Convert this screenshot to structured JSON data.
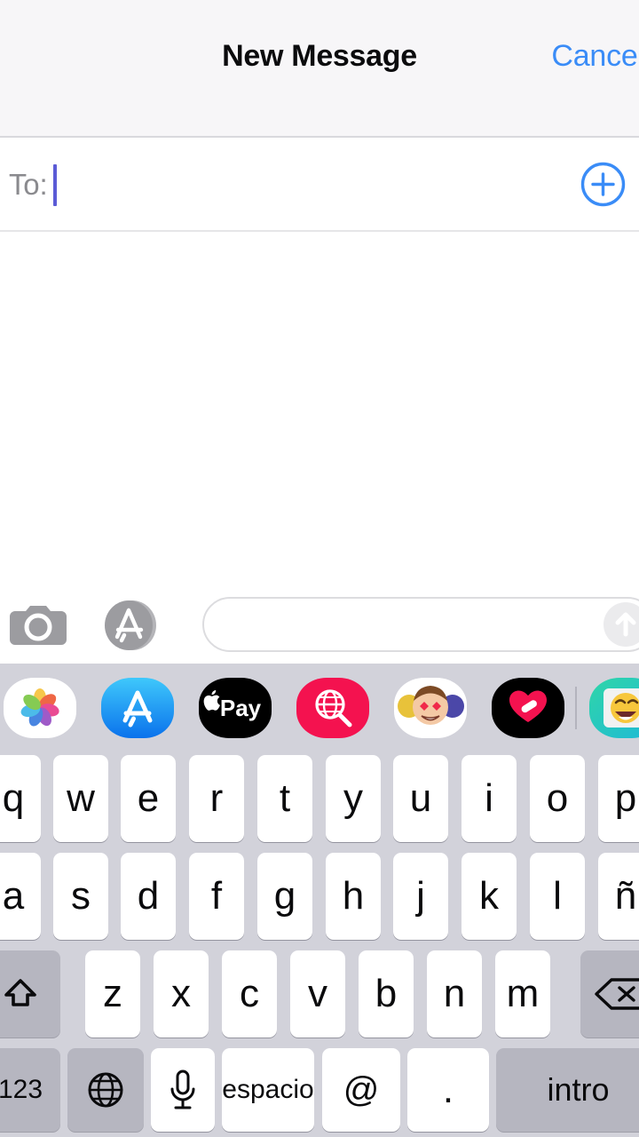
{
  "app": {
    "name": "Messages",
    "platform": "iOS",
    "language": "es"
  },
  "navbar": {
    "title": "New Message",
    "cancel_label": "Cancel",
    "cancel_color": "#3a8cf7",
    "background": "#f7f6f8"
  },
  "recipient_field": {
    "label": "To:",
    "value": "",
    "placeholder": "",
    "caret_visible": true,
    "caret_color": "#5b5bd6",
    "add_contact_icon": "plus-circle-icon",
    "add_contact_color": "#3a8cf7"
  },
  "conversation": {
    "messages": [],
    "empty": true,
    "background": "#ffffff"
  },
  "input_bar": {
    "camera_icon": "camera-icon",
    "appstore_icon": "app-store-icon",
    "message_value": "",
    "message_placeholder": "",
    "send_icon": "arrow-up-icon",
    "send_enabled": false,
    "icon_color": "#a0a0a4"
  },
  "app_drawer": {
    "background": "#d2d2da",
    "apps": [
      {
        "name": "photos",
        "label": "Photos",
        "icon": "photos-pinwheel-icon",
        "bg": "#ffffff"
      },
      {
        "name": "app-store",
        "label": "App Store",
        "icon": "app-store-icon",
        "bg": "#1e9cf5"
      },
      {
        "name": "apple-pay",
        "label": "Apple Pay",
        "icon": "apple-pay-icon",
        "bg": "#000000"
      },
      {
        "name": "images-search",
        "label": "#images",
        "icon": "magnifier-globe-icon",
        "bg": "#f4124f"
      },
      {
        "name": "memoji",
        "label": "Memoji",
        "icon": "memoji-stickers-icon",
        "bg": "#ffffff"
      },
      {
        "name": "digital-touch",
        "label": "Digital Touch",
        "icon": "heart-icon",
        "bg": "#000000"
      },
      {
        "name": "emoji-app",
        "label": "Emoji",
        "icon": "laughing-emoji-icon",
        "bg": "#27c8b7"
      }
    ]
  },
  "keyboard": {
    "layout": "qwerty-spanish",
    "background": "#d2d2da",
    "key_color": "#ffffff",
    "special_key_color": "#b6b6c0",
    "rows": [
      {
        "id": "row1",
        "keys": [
          {
            "label": "q",
            "name": "key-q"
          },
          {
            "label": "w",
            "name": "key-w"
          },
          {
            "label": "e",
            "name": "key-e"
          },
          {
            "label": "r",
            "name": "key-r"
          },
          {
            "label": "t",
            "name": "key-t"
          },
          {
            "label": "y",
            "name": "key-y"
          },
          {
            "label": "u",
            "name": "key-u"
          },
          {
            "label": "i",
            "name": "key-i"
          },
          {
            "label": "o",
            "name": "key-o"
          },
          {
            "label": "p",
            "name": "key-p"
          }
        ]
      },
      {
        "id": "row2",
        "keys": [
          {
            "label": "a",
            "name": "key-a"
          },
          {
            "label": "s",
            "name": "key-s"
          },
          {
            "label": "d",
            "name": "key-d"
          },
          {
            "label": "f",
            "name": "key-f"
          },
          {
            "label": "g",
            "name": "key-g"
          },
          {
            "label": "h",
            "name": "key-h"
          },
          {
            "label": "j",
            "name": "key-j"
          },
          {
            "label": "k",
            "name": "key-k"
          },
          {
            "label": "l",
            "name": "key-l"
          },
          {
            "label": "ñ",
            "name": "key-enye"
          }
        ]
      },
      {
        "id": "row3",
        "keys": [
          {
            "label": "",
            "name": "key-shift",
            "icon": "shift-arrow-icon",
            "style": "dark"
          },
          {
            "label": "z",
            "name": "key-z"
          },
          {
            "label": "x",
            "name": "key-x"
          },
          {
            "label": "c",
            "name": "key-c"
          },
          {
            "label": "v",
            "name": "key-v"
          },
          {
            "label": "b",
            "name": "key-b"
          },
          {
            "label": "n",
            "name": "key-n"
          },
          {
            "label": "m",
            "name": "key-m"
          },
          {
            "label": "",
            "name": "key-backspace",
            "icon": "delete-left-icon",
            "style": "dark"
          }
        ]
      },
      {
        "id": "row4",
        "keys": [
          {
            "label": "123",
            "name": "key-numbers",
            "style": "dark"
          },
          {
            "label": "",
            "name": "key-globe",
            "icon": "globe-icon",
            "style": "dark"
          },
          {
            "label": "",
            "name": "key-dictation",
            "icon": "microphone-icon"
          },
          {
            "label": "espacio",
            "name": "key-space"
          },
          {
            "label": "@",
            "name": "key-at"
          },
          {
            "label": ".",
            "name": "key-period"
          },
          {
            "label": "intro",
            "name": "key-return",
            "style": "dark"
          }
        ]
      }
    ]
  }
}
